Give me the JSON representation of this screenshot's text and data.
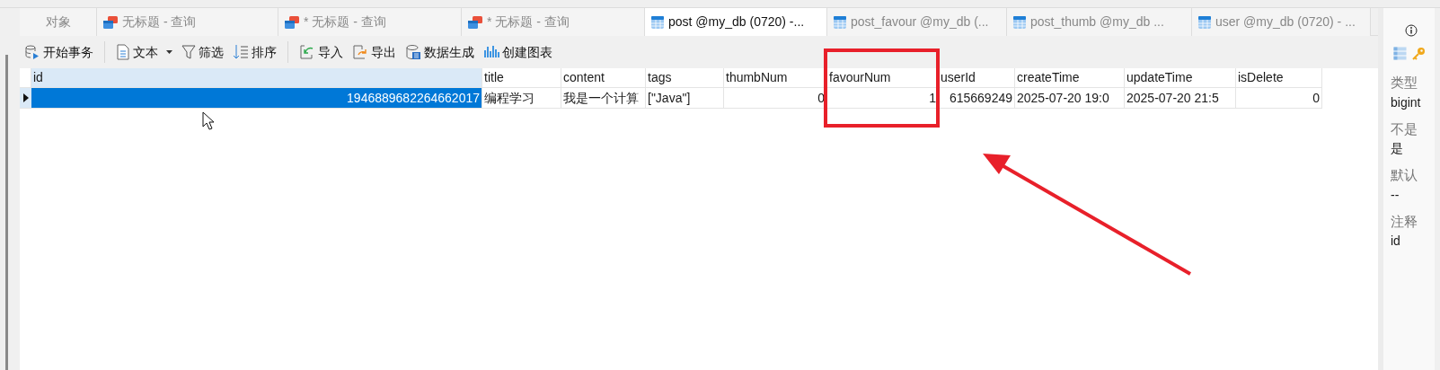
{
  "tabs": [
    {
      "label": "对象",
      "kind": "objects",
      "selected": false
    },
    {
      "label": "无标题 - 查询",
      "kind": "query",
      "selected": false
    },
    {
      "label": "* 无标题 - 查询",
      "kind": "query",
      "selected": false
    },
    {
      "label": "* 无标题 - 查询",
      "kind": "query",
      "selected": false
    },
    {
      "label": "post @my_db (0720) -...",
      "kind": "table",
      "selected": true
    },
    {
      "label": "post_favour @my_db (...",
      "kind": "table",
      "selected": false
    },
    {
      "label": "post_thumb @my_db ...",
      "kind": "table",
      "selected": false
    },
    {
      "label": "user @my_db (0720) - ...",
      "kind": "table",
      "selected": false
    }
  ],
  "toolbar": [
    [
      {
        "label": "开始事务"
      }
    ],
    [
      {
        "label": "文本",
        "dropdown": true
      },
      {
        "label": "筛选"
      },
      {
        "label": "排序"
      }
    ],
    [
      {
        "label": "导入"
      },
      {
        "label": "导出"
      },
      {
        "label": "数据生成"
      },
      {
        "label": "创建图表"
      }
    ]
  ],
  "table": {
    "columns": [
      {
        "label": "id",
        "selected": true
      },
      {
        "label": "title",
        "selected": false
      },
      {
        "label": "content",
        "selected": false
      },
      {
        "label": "tags",
        "selected": false
      },
      {
        "label": "thumbNum",
        "selected": false
      },
      {
        "label": "favourNum",
        "selected": false
      },
      {
        "label": "userId",
        "selected": false
      },
      {
        "label": "createTime",
        "selected": false
      },
      {
        "label": "updateTime",
        "selected": false
      },
      {
        "label": "isDelete",
        "selected": false
      }
    ],
    "rows": [
      {
        "selected": true,
        "cells": [
          "1946889682264662017",
          "编程学习",
          "我是一个计算",
          "[\"Java\"]",
          "0",
          "1",
          "615669249",
          "2025-07-20 19:0",
          "2025-07-20 21:5",
          "0"
        ]
      }
    ]
  },
  "side_panel": {
    "fields": [
      {
        "label": "类型",
        "value": "bigint"
      },
      {
        "label": "不是",
        "value": "是"
      },
      {
        "label": "默认",
        "value": "--"
      },
      {
        "label": "注释",
        "value": "id"
      }
    ]
  }
}
